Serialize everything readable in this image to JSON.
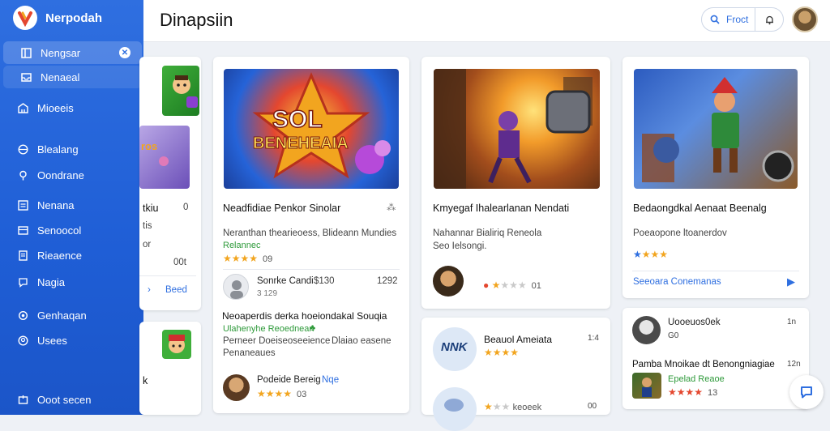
{
  "brand": {
    "name": "Nerpodah"
  },
  "nav": [
    {
      "label": "Nengsar"
    },
    {
      "label": "Nenaeal"
    },
    {
      "label": "Mioeeis"
    },
    {
      "label": "Blealang"
    },
    {
      "label": "Oondrane"
    },
    {
      "label": "Nenana"
    },
    {
      "label": "Senoocol"
    },
    {
      "label": "Rieaence"
    },
    {
      "label": "Nagia"
    },
    {
      "label": "Genhaqan"
    },
    {
      "label": "Usees"
    },
    {
      "label": "Ooot secen"
    }
  ],
  "header": {
    "title": "Dinapsiin",
    "search_label": "Froct"
  },
  "partial": {
    "line1": "tkiu",
    "line1_num": "0",
    "line2": "tis",
    "line3": "or",
    "num": "00t",
    "link": "Beed",
    "bottom": "k"
  },
  "card1": {
    "title": "Neadfidiae Penkor Sinolar",
    "desc": "Neranthan thearieoess, Blideann Mundies",
    "tag": "Relannec",
    "rating_num": "09",
    "user_name": "Sonrke Candi",
    "user_count": "$130",
    "user_right": "1292",
    "user_sub": "3 129",
    "post_title": "Neoaperdis derka hoeiondakal Souqia",
    "post_tag": "Ulahenyhe Reoednean",
    "post_desc1": "Perneer Doeiseoseeience",
    "post_desc2": "Dlaiao easene",
    "post_desc3": "Penaneaues",
    "author_name": "Podeide Bereig",
    "author_link": "Nqe",
    "author_num": "03"
  },
  "card2": {
    "title": "Kmyegaf Ihalearlanan Nendati",
    "desc1": "Nahannar Bialiriq Reneola",
    "desc2": "Seo Ielsongi.",
    "rating_num": "01"
  },
  "card3": {
    "title": "Bedaongdkal Aenaat Beenalg",
    "desc": "Poeaopone ltoanerdov",
    "link": "Seeoara Conemanas"
  },
  "card4": {
    "logo_text": "NNK",
    "title": "Beauol Ameiata",
    "num": "1:4",
    "rating_label": "keoeek",
    "rating_num": "00"
  },
  "card5": {
    "user_name": "Uooeuos0ek",
    "user_sub": "G0",
    "user_num": "1n",
    "title": "Pamba Mnoikae dt Benongniagiae",
    "title_num": "12n",
    "tag": "Epelad Reaoe",
    "rating_num": "13"
  },
  "colors": {
    "accent": "#2f6fe0",
    "star": "#f2a51f",
    "green": "#2e9a3a"
  }
}
